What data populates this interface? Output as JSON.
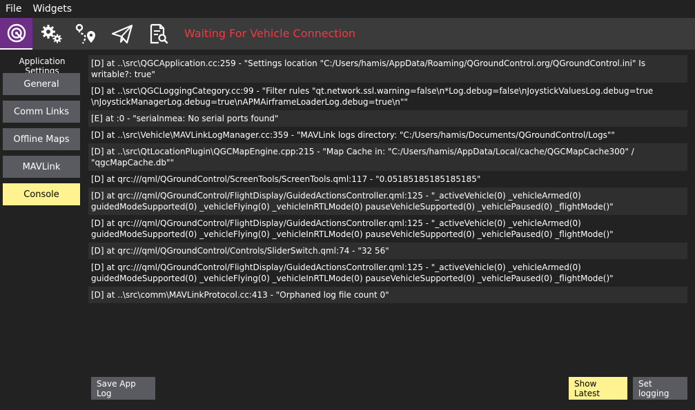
{
  "menubar": {
    "items": [
      "File",
      "Widgets"
    ]
  },
  "toolbar": {
    "status": "Waiting For Vehicle Connection",
    "buttons": [
      {
        "icon": "qgc-logo-icon"
      },
      {
        "icon": "gears-icon"
      },
      {
        "icon": "plan-route-icon"
      },
      {
        "icon": "paper-plane-icon"
      },
      {
        "icon": "analyze-icon"
      }
    ]
  },
  "sidebar": {
    "title": "Application Settings",
    "items": [
      "General",
      "Comm Links",
      "Offline Maps",
      "MAVLink",
      "Console"
    ],
    "selected": "Console"
  },
  "console": {
    "lines": [
      "[D] at ..\\src\\QGCApplication.cc:259 - \"Settings location \"C:/Users/hamis/AppData/Roaming/QGroundControl.org/QGroundControl.ini\" Is writable?: true\"",
      "[D] at ..\\src\\QGCLoggingCategory.cc:99 - \"Filter rules \"qt.network.ssl.warning=false\\n*Log.debug=false\\nJoystickValuesLog.debug=true \\nJoystickManagerLog.debug=true\\nAPMAirframeLoaderLog.debug=true\\n\"\"",
      "[E] at :0 - \"serialnmea: No serial ports found\"",
      "[D] at ..\\src\\Vehicle\\MAVLinkLogManager.cc:359 - \"MAVLink logs directory: \"C:/Users/hamis/Documents/QGroundControl/Logs\"\"",
      "[D] at ..\\src\\QtLocationPlugin\\QGCMapEngine.cpp:215 - \"Map Cache in: \"C:/Users/hamis/AppData/Local/cache/QGCMapCache300\" / \"qgcMapCache.db\"\"",
      "[D] at qrc:///qml/QGroundControl/ScreenTools/ScreenTools.qml:117 - \"0.05185185185185185\"",
      "[D] at qrc:///qml/QGroundControl/FlightDisplay/GuidedActionsController.qml:125 - \"_activeVehicle(0) _vehicleArmed(0) guidedModeSupported(0) _vehicleFlying(0) _vehicleInRTLMode(0) pauseVehicleSupported(0) _vehiclePaused(0) _flightMode()\"",
      "[D] at qrc:///qml/QGroundControl/FlightDisplay/GuidedActionsController.qml:125 - \"_activeVehicle(0) _vehicleArmed(0) guidedModeSupported(0) _vehicleFlying(0) _vehicleInRTLMode(0) pauseVehicleSupported(0) _vehiclePaused(0) _flightMode()\"",
      "[D] at qrc:///qml/QGroundControl/Controls/SliderSwitch.qml:74 - \"32 56\"",
      "[D] at qrc:///qml/QGroundControl/FlightDisplay/GuidedActionsController.qml:125 - \"_activeVehicle(0) _vehicleArmed(0) guidedModeSupported(0) _vehicleFlying(0) _vehicleInRTLMode(0) pauseVehicleSupported(0) _vehiclePaused(0) _flightMode()\"",
      "[D] at ..\\src\\comm\\MAVLinkProtocol.cc:413 - \"Orphaned log file count 0\""
    ]
  },
  "footer": {
    "save_label": "Save App Log",
    "show_latest_label": "Show Latest",
    "set_logging_label": "Set logging"
  },
  "colors": {
    "accent_purple": "#6c2e86",
    "status_red": "#ef3b42",
    "highlight_yellow": "#fff291",
    "button_gray": "#5a5b60"
  }
}
